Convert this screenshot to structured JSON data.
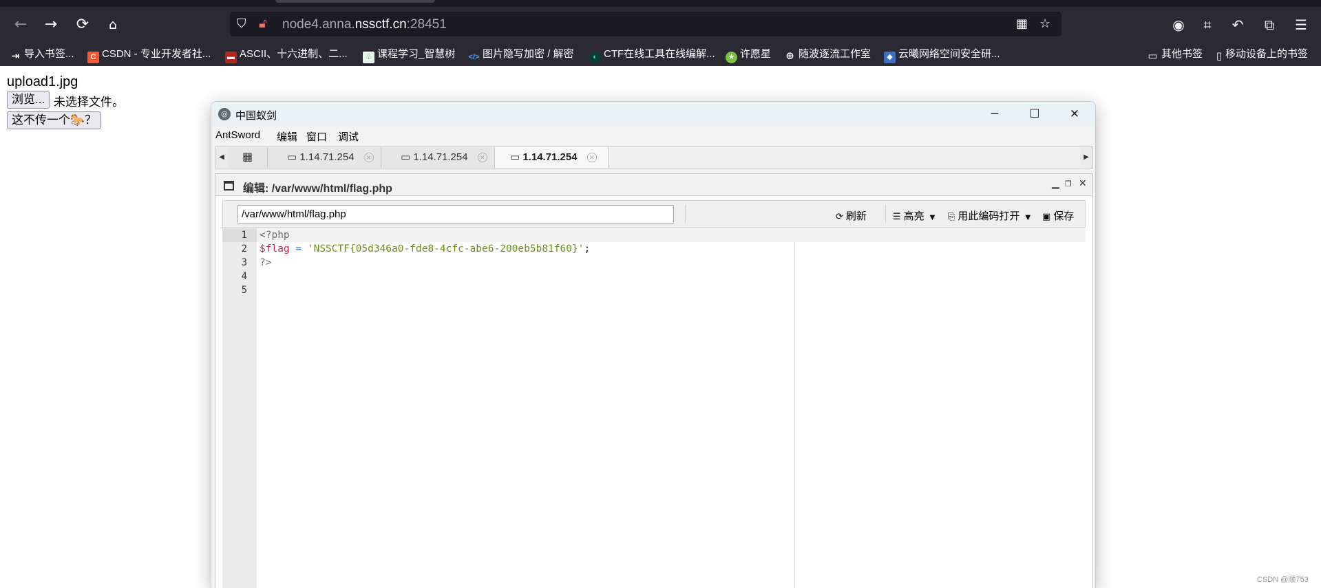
{
  "browser": {
    "url_host_dim": "node4.anna.",
    "url_host_main": "nssctf.cn",
    "url_port": ":28451",
    "bookmarks": [
      {
        "label": "导入书签...",
        "icon": "import-icon"
      },
      {
        "label": "CSDN - 专业开发者社...",
        "icon": "csdn-icon"
      },
      {
        "label": "ASCII、十六进制、二...",
        "icon": "ascii-site-icon"
      },
      {
        "label": "课程学习_智慧树",
        "icon": "zhihuishu-icon"
      },
      {
        "label": "图片隐写加密 / 解密",
        "icon": "code-icon"
      },
      {
        "label": "CTF在线工具在线编解...",
        "icon": "ctf-tool-icon"
      },
      {
        "label": "许愿星",
        "icon": "star-site-icon"
      },
      {
        "label": "随波逐流工作室",
        "icon": "globe-icon"
      },
      {
        "label": "云曦网络空间安全研...",
        "icon": "yunxi-icon"
      },
      {
        "label": "其他书签",
        "icon": "folder-icon"
      },
      {
        "label": "移动设备上的书签",
        "icon": "mobile-icon"
      }
    ]
  },
  "page": {
    "filename": "upload1.jpg",
    "browse_label": "浏览...",
    "no_file_text": "未选择文件。",
    "submit_label": "这不传一个🐎？",
    "watermark": "CSDN @顺753"
  },
  "antsword": {
    "window_title": "中国蚁剑",
    "menu": [
      "AntSword",
      "编辑",
      "窗口",
      "调试"
    ],
    "tabs": [
      {
        "label": "1.14.71.254",
        "active": false
      },
      {
        "label": "1.14.71.254",
        "active": false
      },
      {
        "label": "1.14.71.254",
        "active": true
      }
    ],
    "editor": {
      "title": "编辑: /var/www/html/flag.php",
      "path_value": "/var/www/html/flag.php",
      "toolbar": {
        "refresh": "刷新",
        "highlight": "高亮",
        "open_with_encoding": "用此编码打开",
        "save": "保存"
      },
      "line_numbers": [
        "1",
        "2",
        "3",
        "4",
        "5"
      ],
      "code": {
        "line1": "<?php",
        "line2_var": "$flag",
        "line2_op": " = ",
        "line2_str": "'NSSCTF{05d346a0-fde8-4cfc-abe6-200eb5b81f60}'",
        "line2_end": ";",
        "line3": "?>"
      }
    }
  }
}
